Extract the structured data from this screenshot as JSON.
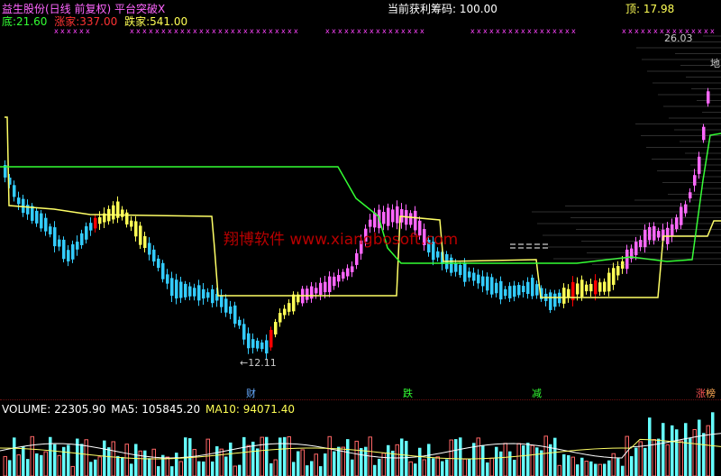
{
  "header": {
    "stock_title": "益生股份(日线 前复权)",
    "indicator_name": "平台突破X",
    "current_profit_label": "当前获利筹码:",
    "current_profit_value": "100.00",
    "top_label": "顶:",
    "top_value": "17.98"
  },
  "legend": {
    "bottom_label": "底:",
    "bottom_value": "21.60",
    "rise_label": "涨家:",
    "rise_value": "337.00",
    "fall_label": "跌家:",
    "fall_value": "541.00"
  },
  "price_labels": {
    "high_label": "26.03",
    "low_label": "12.11",
    "edge_label": "地"
  },
  "watermark": "翔博软件 www.xiangbosoft.com",
  "signals": {
    "s1": "财",
    "s2": "跌",
    "s3": "减",
    "s4": "涨",
    "s4_overlay": "榜"
  },
  "volume": {
    "volume_label": "VOLUME:",
    "volume_value": "22305.90",
    "ma5_label": "MA5:",
    "ma5_value": "105845.20",
    "ma10_label": "MA10:",
    "ma10_value": "94071.40"
  },
  "colors": {
    "background": "#000000",
    "up_candle": "#ff66ff",
    "down_candle": "#33ccff",
    "neutral_candle": "#ffff55",
    "red_candle": "#ff0000",
    "yellow_line": "#ffff66",
    "green_line": "#33ff33",
    "volume_up": "#ff6666",
    "volume_down": "#66ffff",
    "ma_line": "#ffff66",
    "watermark": "#cc0000"
  }
}
